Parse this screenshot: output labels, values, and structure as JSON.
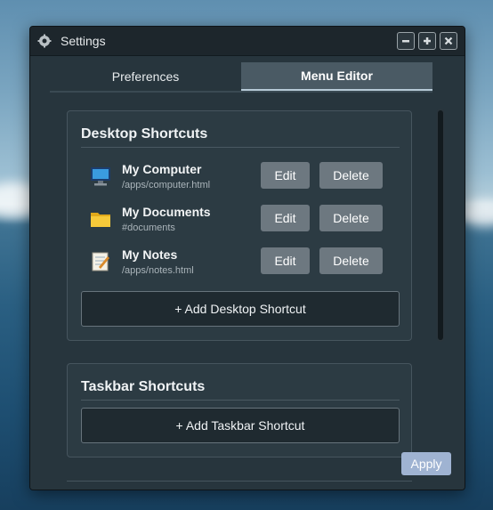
{
  "window": {
    "title": "Settings",
    "icon": "gear-icon",
    "controls": [
      "minimize-icon",
      "maximize-icon",
      "close-icon"
    ]
  },
  "tabs": [
    {
      "label": "Preferences",
      "active": false
    },
    {
      "label": "Menu Editor",
      "active": true
    }
  ],
  "desktop": {
    "title": "Desktop Shortcuts",
    "shortcuts": [
      {
        "name": "My Computer",
        "path": "/apps/computer.html",
        "icon": "computer-icon"
      },
      {
        "name": "My Documents",
        "path": "#documents",
        "icon": "folder-icon"
      },
      {
        "name": "My Notes",
        "path": "/apps/notes.html",
        "icon": "notepad-icon"
      }
    ],
    "edit_label": "Edit",
    "delete_label": "Delete",
    "add_label": "+ Add Desktop Shortcut"
  },
  "taskbar": {
    "title": "Taskbar Shortcuts",
    "add_label": "+ Add Taskbar Shortcut"
  },
  "apply_label": "Apply",
  "colors": {
    "accent": "#9fb3d2",
    "button": "#6d7880",
    "window_bg": "#243038"
  }
}
